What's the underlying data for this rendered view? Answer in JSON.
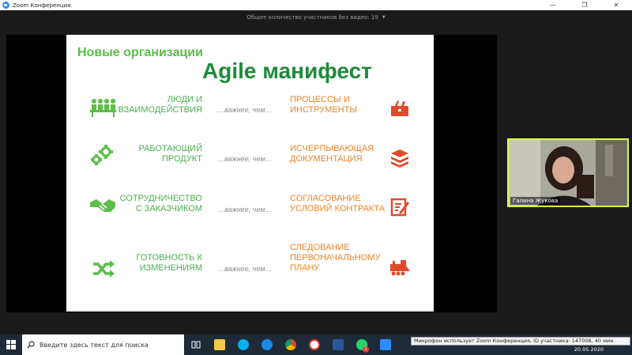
{
  "window": {
    "title": "Zoom Конференция",
    "controls": [
      "—",
      "❐",
      "✕"
    ]
  },
  "share_bar": {
    "label": "Общее количество участников без видео: 19",
    "caret": "▼"
  },
  "slide": {
    "subtitle": "Новые организации",
    "title": "Agile манифест",
    "rows": [
      {
        "left": [
          "ЛЮДИ И",
          "ВЗАИМОДЕЙСТВИЯ"
        ],
        "mid": "…важнее, чем…",
        "right": [
          "ПРОЦЕССЫ И",
          "ИНСТРУМЕНТЫ"
        ],
        "left_icon": "people-meeting-icon",
        "right_icon": "toolbox-icon"
      },
      {
        "left": [
          "РАБОТАЮЩИЙ",
          "ПРОДУКТ"
        ],
        "mid": "…важнее, чем…",
        "right": [
          "ИСЧЕРПЫВАЮЩАЯ",
          "ДОКУМЕНТАЦИЯ"
        ],
        "left_icon": "gears-icon",
        "right_icon": "document-stack-icon"
      },
      {
        "left": [
          "СОТРУДНИЧЕСТВО",
          "С ЗАКАЗЧИКОМ"
        ],
        "mid": "…важнее, чем…",
        "right": [
          "СОГЛАСОВАНИЕ",
          "УСЛОВИЙ КОНТРАКТА"
        ],
        "left_icon": "handshake-icon",
        "right_icon": "contract-edit-icon"
      },
      {
        "left": [
          "ГОТОВНОСТЬ К",
          "ИЗМЕНЕНИЯМ"
        ],
        "mid": "…важнее, чем…",
        "right": [
          "СЛЕДОВАНИЕ",
          "ПЕРВОНАЧАЛЬНОМУ",
          "ПЛАНУ"
        ],
        "left_icon": "shuffle-arrows-icon",
        "right_icon": "train-icon"
      }
    ],
    "colors": {
      "green_light": "#5cbd4a",
      "green_dark": "#1f8a3a",
      "orange": "#e8862a",
      "red_icon": "#e04a2a"
    }
  },
  "video": {
    "participant_name": "Галина Жукова",
    "border_color": "#d9ff3d"
  },
  "taskbar": {
    "search_placeholder": "Введите здесь текст для поиска",
    "notification_badge": "1",
    "toast": "Микрофон использует Zoom Конференция, ID участника: 147008, 40 мин",
    "date": "20.05.2020",
    "apps": [
      "task-view-icon",
      "file-explorer-icon",
      "skype-icon",
      "edge-icon",
      "chrome-icon",
      "yandex-icon",
      "word-icon",
      "whatsapp-icon",
      "zoom-icon"
    ]
  }
}
